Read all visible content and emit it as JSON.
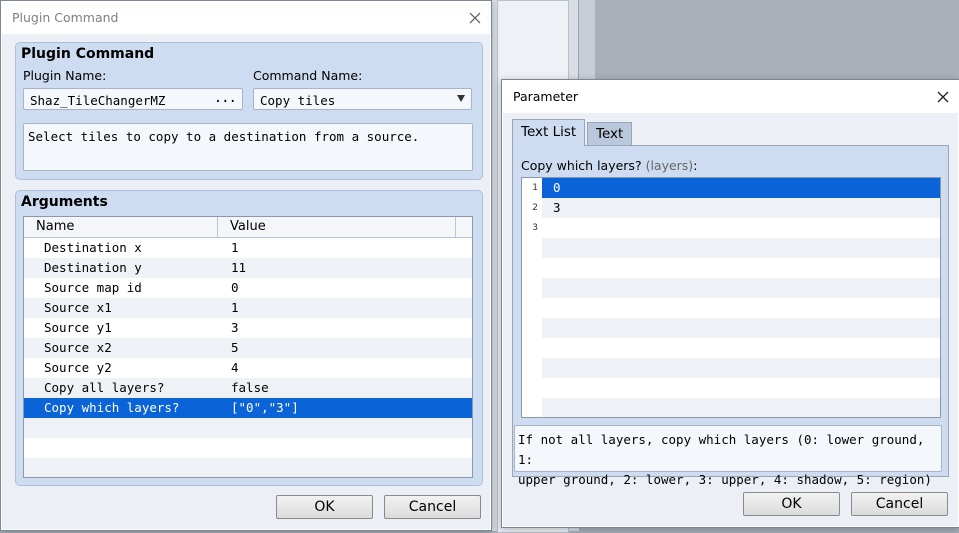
{
  "plugin_dialog": {
    "title": "Plugin Command",
    "section_title": "Plugin Command",
    "plugin_name_label": "Plugin Name:",
    "plugin_name_value": "Shaz_TileChangerMZ",
    "plugin_name_button": "...",
    "command_name_label": "Command Name:",
    "command_name_value": "Copy tiles",
    "description": "Select tiles to copy to a destination from a source.",
    "arguments_title": "Arguments",
    "columns": [
      "Name",
      "Value"
    ],
    "rows": [
      {
        "name": "Destination x",
        "value": "1"
      },
      {
        "name": "Destination y",
        "value": "11"
      },
      {
        "name": "Source map id",
        "value": "0"
      },
      {
        "name": "Source x1",
        "value": "1"
      },
      {
        "name": "Source y1",
        "value": "3"
      },
      {
        "name": "Source x2",
        "value": "5"
      },
      {
        "name": "Source y2",
        "value": "4"
      },
      {
        "name": "Copy all layers?",
        "value": "false"
      },
      {
        "name": "Copy which layers?",
        "value": "[\"0\",\"3\"]"
      }
    ],
    "selected_row_index": 8,
    "ok_label": "OK",
    "cancel_label": "Cancel"
  },
  "parameter_dialog": {
    "title": "Parameter",
    "tabs": [
      {
        "label": "Text List",
        "active": true
      },
      {
        "label": "Text",
        "active": false
      }
    ],
    "field_label": "Copy which layers?",
    "field_hint": "(layers)",
    "field_colon": ":",
    "line_numbers": [
      "1",
      "2",
      "3"
    ],
    "lines": [
      "0",
      "3",
      ""
    ],
    "selected_line_index": 0,
    "help_text_line1": "If not all layers, copy which layers (0: lower ground, 1:",
    "help_text_line2": "upper ground, 2: lower, 3: upper, 4: shadow, 5: region)",
    "ok_label": "OK",
    "cancel_label": "Cancel"
  },
  "colors": {
    "selection": "#0a64d8",
    "group_bg": "#cddcf0",
    "panel_bg": "#ecf0f6"
  },
  "icons": {
    "close": "close-icon",
    "dropdown": "chevron-down-icon"
  }
}
